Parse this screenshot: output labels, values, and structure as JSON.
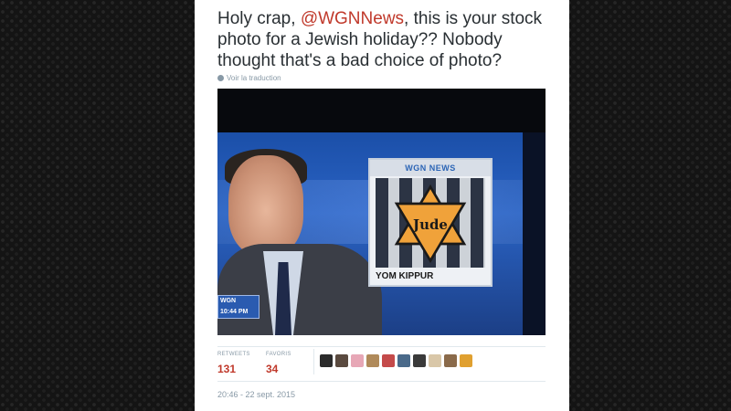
{
  "tweet": {
    "text_before": "Holy crap, ",
    "mention": "@WGNNews",
    "text_after": ", this is your stock photo for a Jewish holiday?? Nobody thought that's a bad choice of photo?",
    "translate_label": "Voir la traduction",
    "timestamp": "20:46 - 22 sept. 2015"
  },
  "media": {
    "chyron_logo": "WGN",
    "chyron_time": "10:44 PM",
    "inset_logo": "WGN NEWS",
    "inset_star_text": "Jude",
    "inset_caption": "YOM KIPPUR"
  },
  "stats": {
    "retweets_label": "RETWEETS",
    "retweets_value": "131",
    "favorites_label": "FAVORIS",
    "favorites_value": "34"
  },
  "avatars": [
    {
      "name": "avatar-1",
      "color": "#2b2b2b"
    },
    {
      "name": "avatar-2",
      "color": "#5a4a3f"
    },
    {
      "name": "avatar-3",
      "color": "#e7a7b6"
    },
    {
      "name": "avatar-4",
      "color": "#b08a5a"
    },
    {
      "name": "avatar-5",
      "color": "#c44a4a"
    },
    {
      "name": "avatar-6",
      "color": "#4a6a8a"
    },
    {
      "name": "avatar-7",
      "color": "#3a3a3a"
    },
    {
      "name": "avatar-8",
      "color": "#d9c7a8"
    },
    {
      "name": "avatar-9",
      "color": "#8a6a4a"
    },
    {
      "name": "avatar-10",
      "color": "#e0a030"
    }
  ]
}
